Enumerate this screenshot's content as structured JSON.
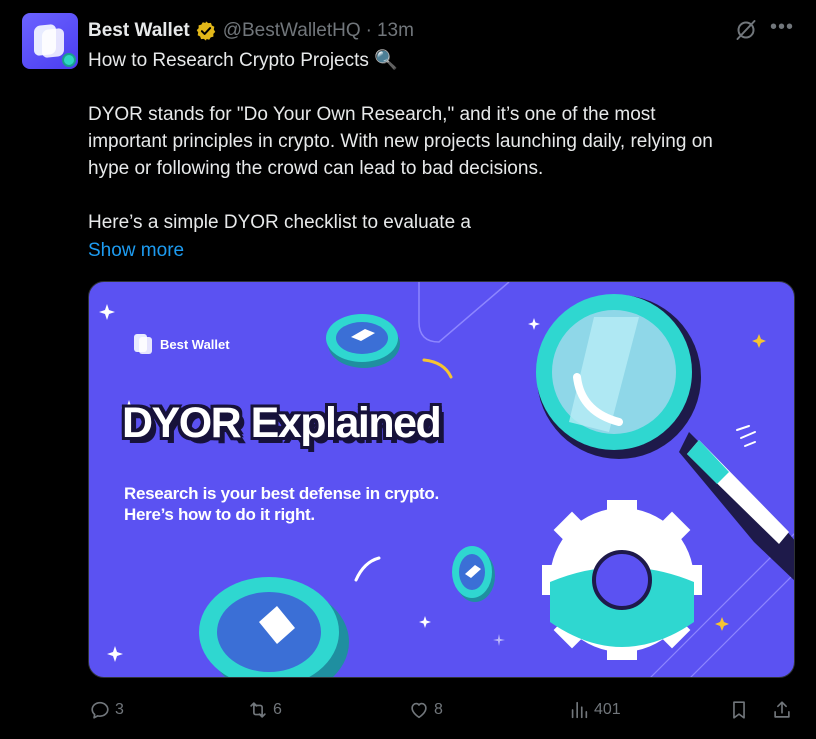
{
  "author": {
    "name": "Best Wallet",
    "handle": "@BestWalletHQ",
    "separator": "·",
    "time": "13m"
  },
  "tweet": {
    "line1": "How to Research Crypto Projects 🔍",
    "para2_l1": "DYOR stands for \"Do Your Own Research,\" and it’s one of the most",
    "para2_l2": "important principles in crypto. With new projects launching daily, relying on",
    "para2_l3": "hype or following the crowd can lead to bad decisions.",
    "para3_l1": "Here’s a simple DYOR checklist to evaluate a",
    "show_more": "Show more"
  },
  "media": {
    "brand": "Best Wallet",
    "title": "DYOR Explained",
    "subtitle_l1": "Research is your best defense in crypto.",
    "subtitle_l2": "Here’s how to do it right.",
    "colors": {
      "background": "#5b52f2",
      "teal": "#2fd7d0",
      "dark": "#17123a"
    }
  },
  "actions": {
    "replies": "3",
    "reposts": "6",
    "likes": "8",
    "views": "401"
  },
  "icons": [
    "verified-badge-icon",
    "grok-icon",
    "more-icon",
    "reply-icon",
    "repost-icon",
    "like-icon",
    "views-icon",
    "bookmark-icon",
    "share-icon"
  ]
}
